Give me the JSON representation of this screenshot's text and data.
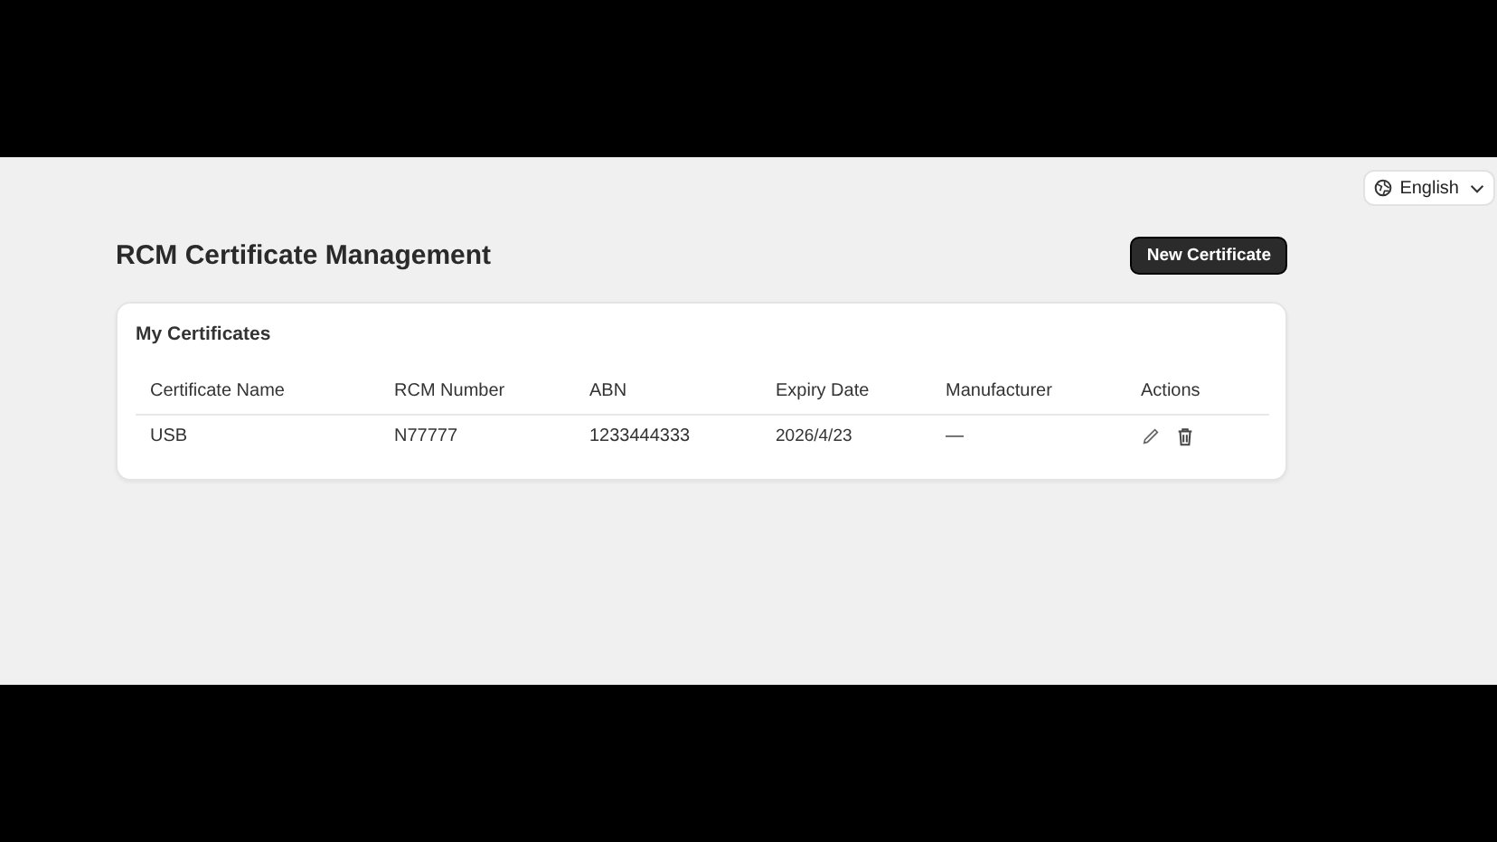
{
  "language": {
    "label": "English"
  },
  "page": {
    "title": "RCM Certificate Management",
    "new_button": "New Certificate"
  },
  "card": {
    "title": "My Certificates",
    "columns": [
      "Certificate Name",
      "RCM Number",
      "ABN",
      "Expiry Date",
      "Manufacturer",
      "Actions"
    ],
    "rows": [
      {
        "name": "USB",
        "rcm": "N77777",
        "abn": "1233444333",
        "expiry": "2026/4/23",
        "manufacturer": "—"
      }
    ]
  }
}
